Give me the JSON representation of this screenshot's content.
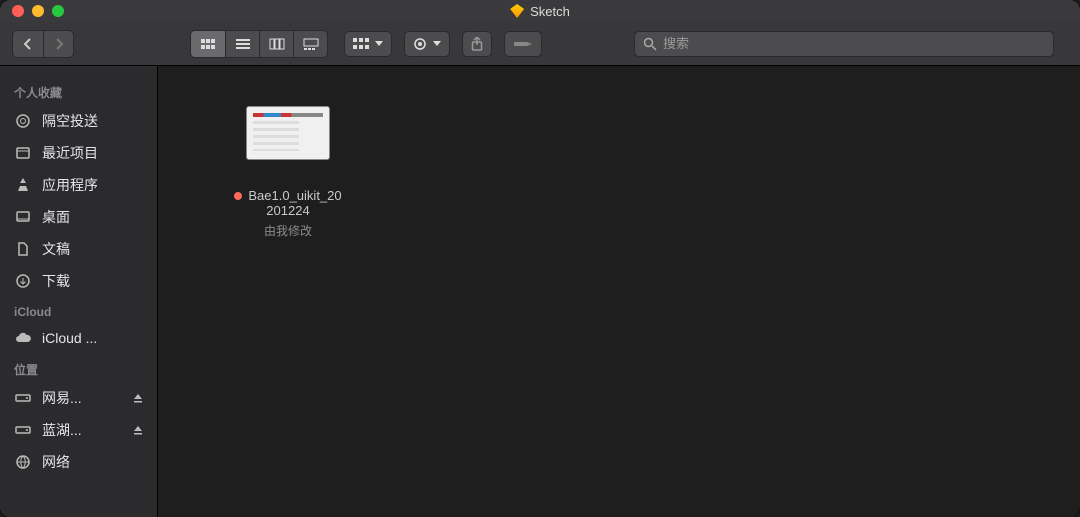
{
  "window": {
    "title": "Sketch"
  },
  "search": {
    "placeholder": "搜索"
  },
  "sidebar": {
    "groups": [
      {
        "label": "个人收藏",
        "items": [
          {
            "name": "隔空投送",
            "icon": "airdrop"
          },
          {
            "name": "最近项目",
            "icon": "recents"
          },
          {
            "name": "应用程序",
            "icon": "apps"
          },
          {
            "name": "桌面",
            "icon": "desktop"
          },
          {
            "name": "文稿",
            "icon": "documents"
          },
          {
            "name": "下载",
            "icon": "downloads"
          }
        ]
      },
      {
        "label": "iCloud",
        "items": [
          {
            "name": "iCloud ...",
            "icon": "cloud"
          }
        ]
      },
      {
        "label": "位置",
        "items": [
          {
            "name": "网易...",
            "icon": "disk",
            "eject": true
          },
          {
            "name": "蓝湖...",
            "icon": "disk",
            "eject": true
          },
          {
            "name": "网络",
            "icon": "network"
          }
        ]
      }
    ]
  },
  "files": [
    {
      "name_l1": "Bae1.0_uikit_20",
      "name_l2": "201224",
      "sub": "由我修改",
      "status": "modified"
    }
  ]
}
